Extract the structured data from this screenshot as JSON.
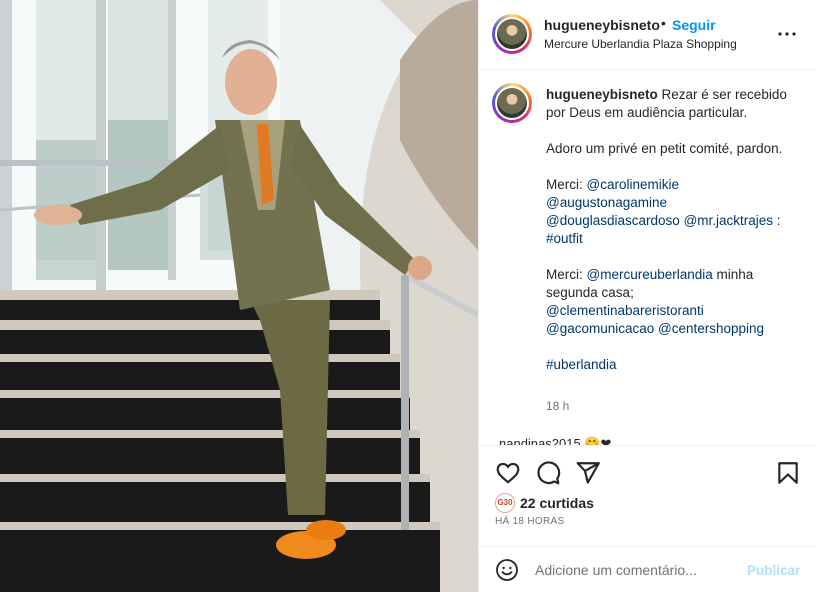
{
  "post": {
    "username": "hugueneybisneto",
    "follow_label": "Seguir",
    "separator": "•",
    "location": "Mercure Uberlandia Plaza Shopping"
  },
  "caption": {
    "username": "hugueneybisneto",
    "line1": "Rezar é ser recebido por Deus em audiência particular.",
    "line2": "Adoro um privé en petit comité, pardon.",
    "merci1_prefix": "Merci: ",
    "mention_carolinemikie": "@carolinemikie",
    "mention_augustonagamine": "@augustonagamine",
    "mention_douglasdiascardoso": "@douglasdiascardoso",
    "mention_mrjacktrajes": "@mr.jacktrajes",
    "merci1_suffix": " :",
    "hashtag_outfit": "#outfit",
    "merci2_prefix": "Merci: ",
    "mention_mercureuberlandia": "@mercureuberlandia",
    "merci2_middle": " minha segunda casa;",
    "mention_clementinabareristoranti": "@clementinabareristoranti",
    "mention_gacomunicacao": "@gacomunicacao",
    "mention_centershopping": "@centershopping",
    "hashtag_uberlandia": "#uberlandia",
    "time": "18 h"
  },
  "next_comment": {
    "text": "nandinas2015 🤭❤"
  },
  "actions": {
    "likes_avatar_text": "G30",
    "likes_text": "22 curtidas",
    "posted": "HÁ 18 HORAS"
  },
  "comment_box": {
    "placeholder": "Adicione um comentário...",
    "publish_label": "Publicar"
  },
  "icons": {
    "more": "more-options-icon",
    "like": "heart-icon",
    "comment": "comment-icon",
    "share": "paper-plane-icon",
    "save": "bookmark-icon",
    "emoji": "smiley-icon"
  },
  "colors": {
    "link_blue": "#0095f6",
    "mention_navy": "#00376b",
    "publish_disabled": "#b2dffc",
    "muted_text": "#737373"
  }
}
